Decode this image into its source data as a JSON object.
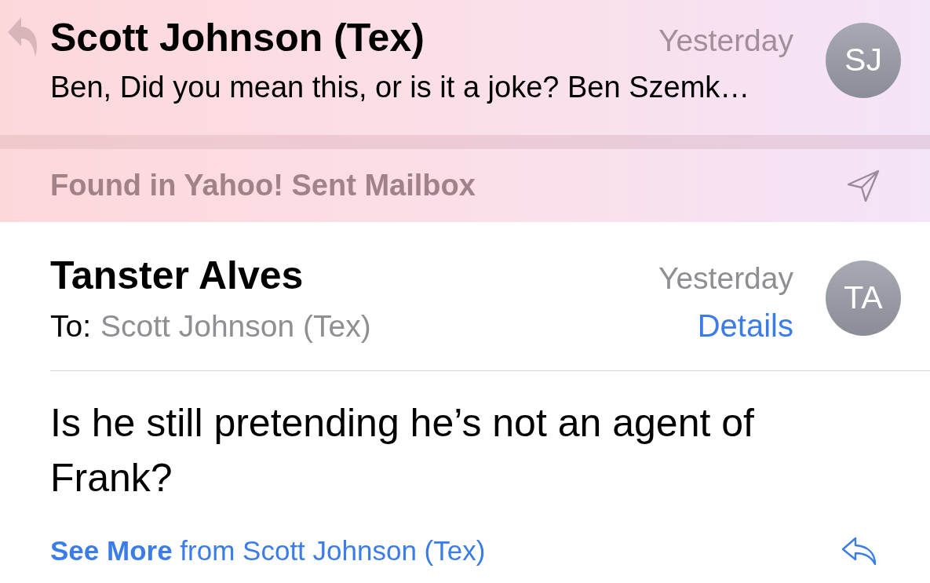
{
  "message_header": {
    "sender": "Scott Johnson (Tex)",
    "date": "Yesterday",
    "preview": "Ben, Did you mean this, or is it a joke? Ben Szemk…",
    "avatar_initials": "SJ",
    "replied": true
  },
  "found_in": {
    "text": "Found in Yahoo! Sent Mailbox"
  },
  "message": {
    "sender": "Tanster Alves",
    "date": "Yesterday",
    "to_label": "To:",
    "recipient": "Scott Johnson (Tex)",
    "details_link": "Details",
    "avatar_initials": "TA",
    "body": "Is he still pretending he’s not an agent of Frank?",
    "see_more": "**See More** from Scott Johnson (Tex)"
  }
}
